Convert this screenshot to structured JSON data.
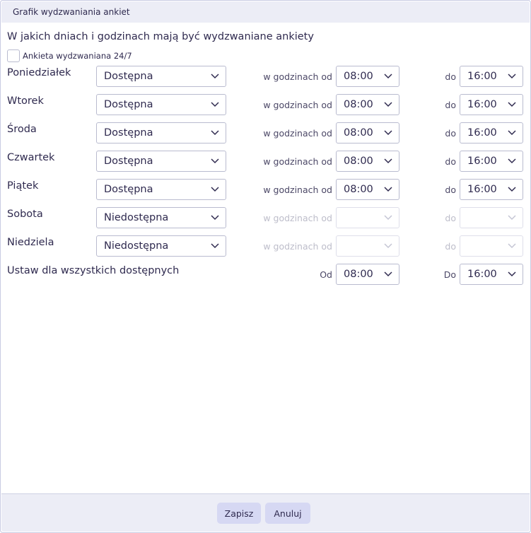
{
  "dialog": {
    "title": "Grafik wydzwaniania ankiet"
  },
  "heading": "W jakich dniach i godzinach mają być wydzwaniane ankiety",
  "checkbox_247": {
    "label": "Ankieta wydzwaniana 24/7",
    "checked": false
  },
  "labels": {
    "from": "w godzinach od",
    "to": "do",
    "all_from": "Od",
    "all_to": "Do"
  },
  "days": [
    {
      "name": "Poniedziałek",
      "availability": "Dostępna",
      "from": "08:00",
      "to": "16:00",
      "enabled": true
    },
    {
      "name": "Wtorek",
      "availability": "Dostępna",
      "from": "08:00",
      "to": "16:00",
      "enabled": true
    },
    {
      "name": "Środa",
      "availability": "Dostępna",
      "from": "08:00",
      "to": "16:00",
      "enabled": true
    },
    {
      "name": "Czwartek",
      "availability": "Dostępna",
      "from": "08:00",
      "to": "16:00",
      "enabled": true
    },
    {
      "name": "Piątek",
      "availability": "Dostępna",
      "from": "08:00",
      "to": "16:00",
      "enabled": true
    },
    {
      "name": "Sobota",
      "availability": "Niedostępna",
      "from": "",
      "to": "",
      "enabled": false
    },
    {
      "name": "Niedziela",
      "availability": "Niedostępna",
      "from": "",
      "to": "",
      "enabled": false
    }
  ],
  "set_all": {
    "label": "Ustaw dla wszystkich dostępnych",
    "from": "08:00",
    "to": "16:00"
  },
  "footer": {
    "save_label": "Zapisz",
    "cancel_label": "Anuluj"
  }
}
